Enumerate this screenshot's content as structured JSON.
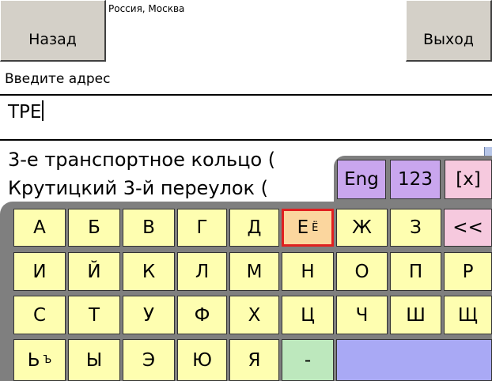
{
  "header": {
    "back_label": "Назад",
    "region": "Россия, Москва",
    "exit_label": "Выход"
  },
  "prompt": "Введите адрес",
  "input_value": "ТРЕ",
  "results": [
    "3-е транспортное кольцо (",
    "Крутицкий 3-й переулок ("
  ],
  "keyboard": {
    "mode_keys": [
      "Eng",
      "123",
      "[x]"
    ],
    "rows": [
      [
        "А",
        "Б",
        "В",
        "Г",
        "Д",
        "Е",
        "Ж",
        "З",
        "<<"
      ],
      [
        "И",
        "Й",
        "К",
        "Л",
        "М",
        "Н",
        "О",
        "П",
        "Р"
      ],
      [
        "С",
        "Т",
        "У",
        "Ф",
        "Х",
        "Ц",
        "Ч",
        "Ш",
        "Щ"
      ],
      [
        "Ь",
        "Ы",
        "Э",
        "Ю",
        "Я",
        "-"
      ]
    ],
    "alt_e": "Ё",
    "alt_soft": "Ъ",
    "selected_key": "Е"
  },
  "colors": {
    "key_yellow": "#fefeb0",
    "key_purple": "#c9a6ee",
    "key_pink": "#f6c9de",
    "key_green": "#bde8bd",
    "key_space": "#a9a9f5",
    "selected_border": "#e02020",
    "keyboard_bg": "#7f7f7f"
  }
}
